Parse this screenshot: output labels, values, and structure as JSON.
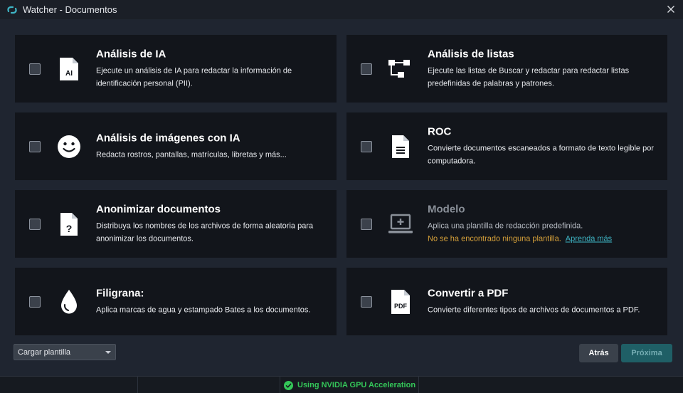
{
  "window": {
    "title": "Watcher - Documentos",
    "logo_icon": "watcher-logo-icon",
    "close_icon": "close-icon"
  },
  "cards": [
    {
      "title": "Análisis de IA",
      "desc": "Ejecute un análisis de IA para redactar la información de identificación personal (PII).",
      "icon": "ai-document-icon",
      "icon_label": "AI",
      "checked": false
    },
    {
      "title": "Análisis de listas",
      "desc": "Ejecute las listas de Buscar y redactar para redactar listas predefinidas de palabras y patrones.",
      "icon": "flow-list-icon",
      "checked": false
    },
    {
      "title": "Análisis de imágenes con IA",
      "desc": "Redacta rostros, pantallas, matrículas, libretas y más...",
      "icon": "smiley-face-icon",
      "checked": false
    },
    {
      "title": "ROC",
      "desc": "Convierte documentos escaneados a formato de texto legible por computadora.",
      "icon": "text-document-icon",
      "checked": false
    },
    {
      "title": "Anonimizar documentos",
      "desc": "Distribuya los nombres de los archivos de forma aleatoria para anonimizar los documentos.",
      "icon": "question-document-icon",
      "icon_label": "?",
      "checked": false
    },
    {
      "title": "Modelo",
      "desc": "Aplica una plantilla de redacción predefinida.",
      "warning": "No se ha encontrado ninguna plantilla.",
      "link": "Aprenda más",
      "icon": "laptop-plus-icon",
      "checked": false,
      "disabled": true
    },
    {
      "title": "Filigrana:",
      "desc": "Aplica marcas de agua y estampado Bates a los documentos.",
      "icon": "water-drop-icon",
      "checked": false
    },
    {
      "title": "Convertir a PDF",
      "desc": "Convierte diferentes tipos de archivos de documentos a PDF.",
      "icon": "pdf-document-icon",
      "icon_label": "PDF",
      "checked": false
    }
  ],
  "footer": {
    "template_select": "Cargar plantilla",
    "back_label": "Atrás",
    "next_label": "Próxima"
  },
  "status": {
    "gpu_label": "Using NVIDIA GPU Acceleration",
    "gpu_icon": "check-circle-icon"
  },
  "colors": {
    "accent": "#3fb6c6",
    "warning": "#d8a23a",
    "success": "#34c759",
    "card_bg": "#12151b",
    "window_bg": "#1f2530"
  }
}
